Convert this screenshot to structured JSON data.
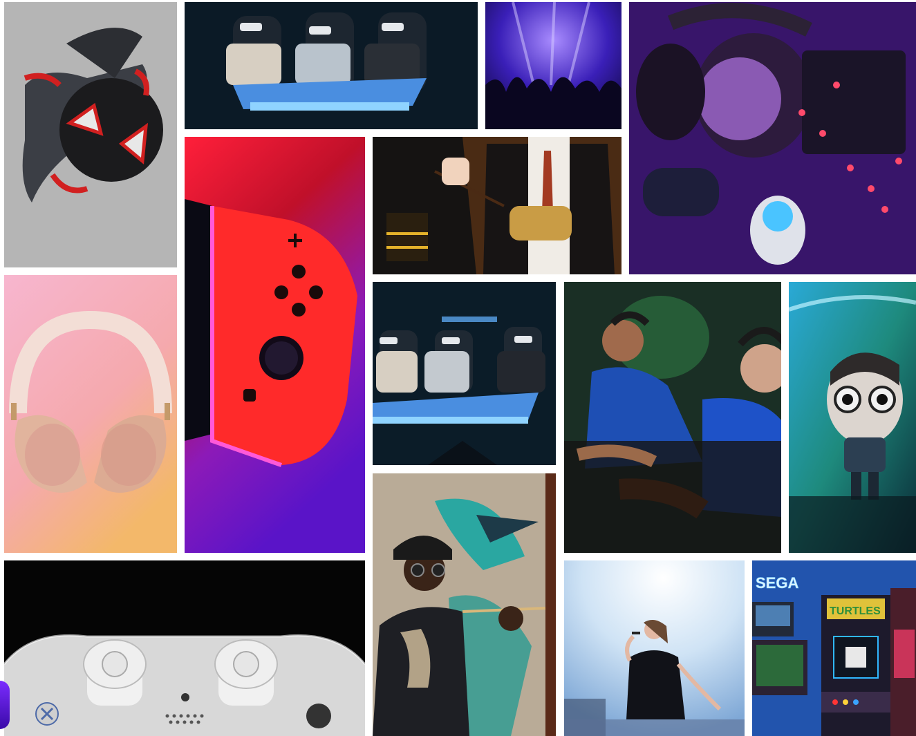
{
  "gallery": {
    "tiles": [
      {
        "id": "spiderman-plush",
        "subject": "spiderman-plush"
      },
      {
        "id": "vr-theater-1",
        "subject": "vr-theater"
      },
      {
        "id": "concert-crowd",
        "subject": "concert-crowd"
      },
      {
        "id": "gaming-headset-desk",
        "subject": "gaming-headset-desk"
      },
      {
        "id": "switch-controller",
        "subject": "switch-controller"
      },
      {
        "id": "wizard-costumes",
        "subject": "wizard-costumes"
      },
      {
        "id": "headphones-pink",
        "subject": "headphones-pink"
      },
      {
        "id": "vr-theater-2",
        "subject": "vr-theater"
      },
      {
        "id": "esports-players",
        "subject": "esports-players"
      },
      {
        "id": "funko-figure",
        "subject": "funko-figure"
      },
      {
        "id": "painter-mural",
        "subject": "painter-mural"
      },
      {
        "id": "playstation-controller",
        "subject": "playstation-controller"
      },
      {
        "id": "singer-stage",
        "subject": "singer-stage"
      },
      {
        "id": "arcade-cabinets",
        "subject": "arcade-cabinets",
        "sign_text": "SEGA",
        "marquee_text": "TURTLES"
      }
    ]
  },
  "colors": {
    "background": "#ffffff",
    "accent": "#6a2cff"
  }
}
